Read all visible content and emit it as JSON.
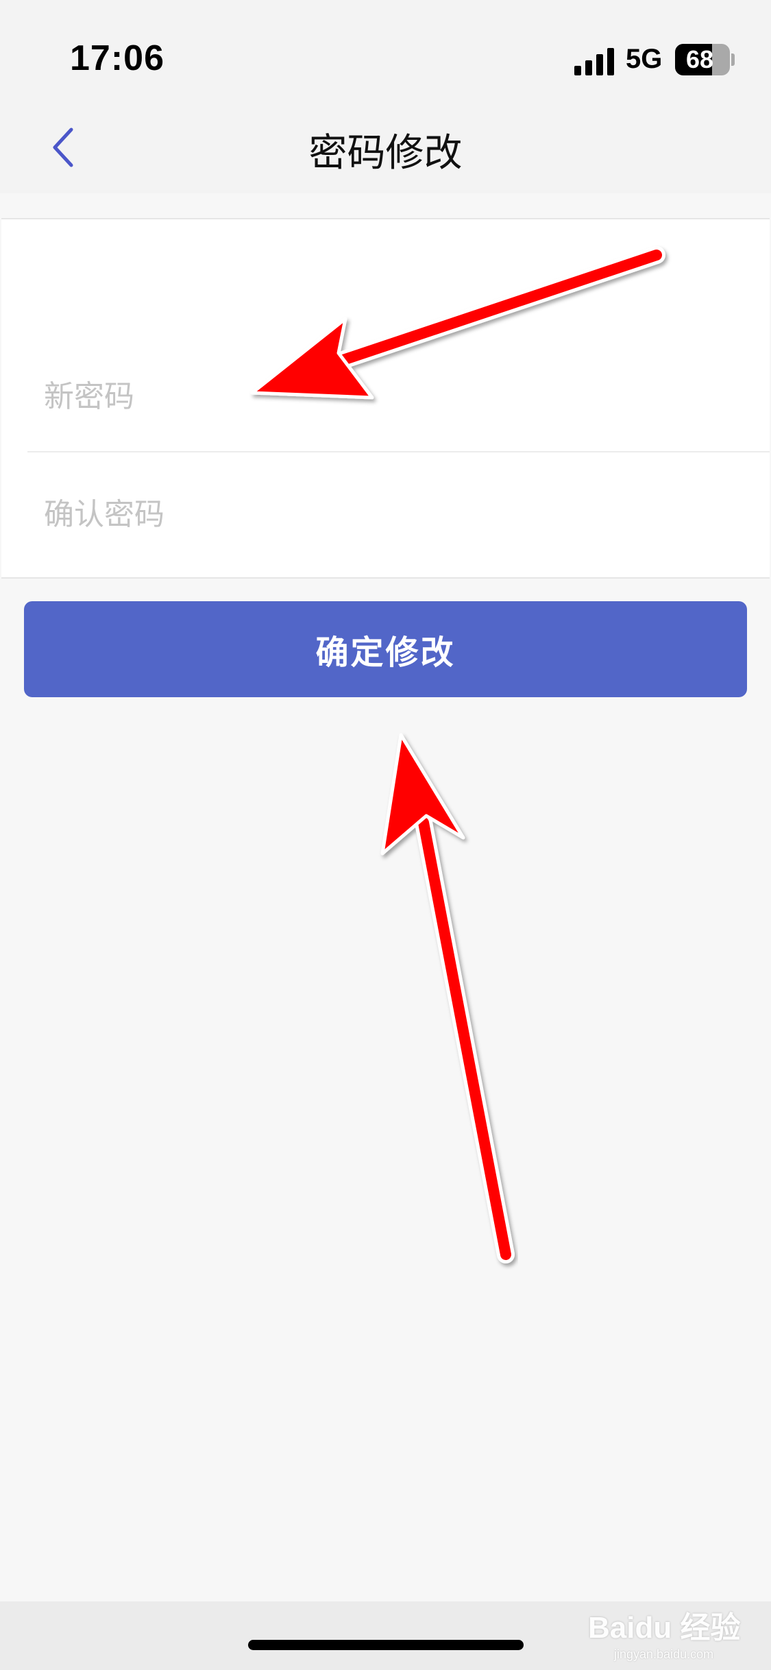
{
  "status_bar": {
    "time": "17:06",
    "network": "5G",
    "battery_level": "68",
    "battery_fraction": 0.68
  },
  "nav": {
    "title": "密码修改",
    "back_icon": "chevron-left-icon"
  },
  "form": {
    "new_password_placeholder": "新密码",
    "confirm_password_placeholder": "确认密码",
    "submit_label": "确定修改"
  },
  "watermark": {
    "brand": "Baidu 经验",
    "domain": "jingyan.baidu.com"
  },
  "colors": {
    "accent": "#5266c8",
    "background": "#f7f7f7",
    "annotation_arrow": "#ff0000"
  }
}
